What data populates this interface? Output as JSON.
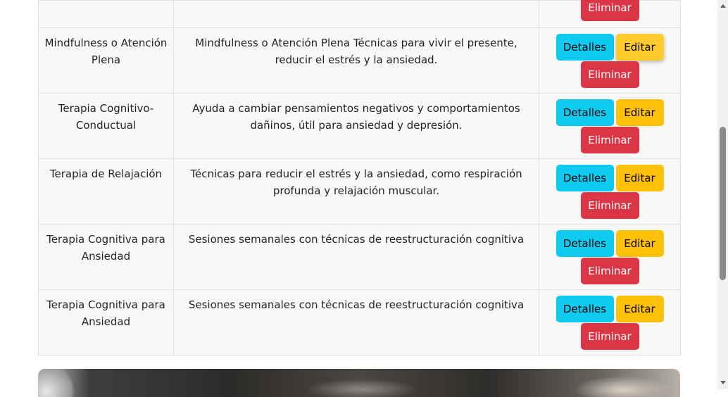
{
  "buttons": {
    "details": "Detalles",
    "edit": "Editar",
    "delete": "Eliminar"
  },
  "rows": [
    {
      "name": "",
      "description": ""
    },
    {
      "name": "Mindfulness o Atención Plena",
      "description": "Mindfulness o Atención Plena Técnicas para vivir el presente, reducir el estrés y la ansiedad."
    },
    {
      "name": "Terapia Cognitivo-Conductual",
      "description": "Ayuda a cambiar pensamientos negativos y comportamientos dañinos, útil para ansiedad y depresión."
    },
    {
      "name": "Terapia de Relajación",
      "description": "Técnicas para reducir el estrés y la ansiedad, como respiración profunda y relajación muscular."
    },
    {
      "name": "Terapia Cognitiva para Ansiedad",
      "description": "Sesiones semanales con técnicas de reestructuración cognitiva"
    },
    {
      "name": "Terapia Cognitiva para Ansiedad",
      "description": "Sesiones semanales con técnicas de reestructuración cognitiva"
    }
  ],
  "colors": {
    "info": "#0dcaf0",
    "warning": "#ffc107",
    "danger": "#dc3545",
    "row_bg": "#f8f8f8",
    "border": "#dee2e6"
  }
}
